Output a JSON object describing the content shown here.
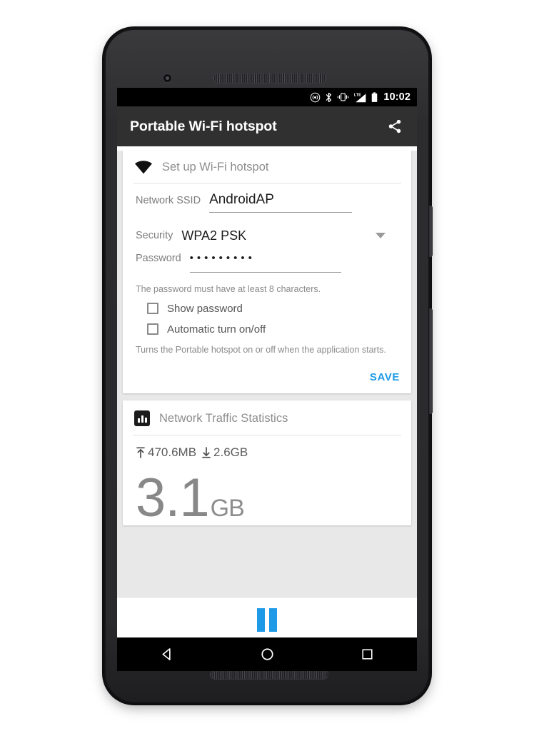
{
  "status_bar": {
    "time": "10:02",
    "icons": [
      "hotspot-icon",
      "bluetooth-icon",
      "vibrate-icon",
      "lte-signal-icon",
      "battery-icon"
    ]
  },
  "app_bar": {
    "title": "Portable Wi-Fi hotspot",
    "share_icon": "share-icon"
  },
  "setup_card": {
    "header_icon": "wifi-icon",
    "header_title": "Set up Wi-Fi hotspot",
    "ssid": {
      "label": "Network SSID",
      "value": "AndroidAP"
    },
    "security": {
      "label": "Security",
      "value": "WPA2 PSK",
      "dropdown_icon": "chevron-down-icon"
    },
    "password": {
      "label": "Password",
      "value": "•••••••••"
    },
    "password_hint": "The password must have at least 8 characters.",
    "checkboxes": [
      {
        "label": "Show password",
        "checked": false
      },
      {
        "label": "Automatic turn on/off",
        "checked": false
      }
    ],
    "auto_hint": "Turns the Portable hotspot on or off when the application starts.",
    "save_label": "SAVE"
  },
  "stats_card": {
    "header_icon": "bar-chart-icon",
    "header_title": "Network Traffic Statistics",
    "upload": {
      "icon": "upload-icon",
      "value": "470.6MB"
    },
    "download": {
      "icon": "download-icon",
      "value": "2.6GB"
    },
    "total_value": "3.1",
    "total_unit": "GB"
  },
  "pause_bar": {
    "icon": "pause-icon"
  },
  "nav_bar": {
    "back": "back-triangle-icon",
    "home": "home-circle-icon",
    "recents": "recents-square-icon"
  },
  "colors": {
    "accent": "#1e9ae6",
    "app_bar": "#303030",
    "status_bar": "#000000",
    "content_bg": "#e8e8e8"
  }
}
